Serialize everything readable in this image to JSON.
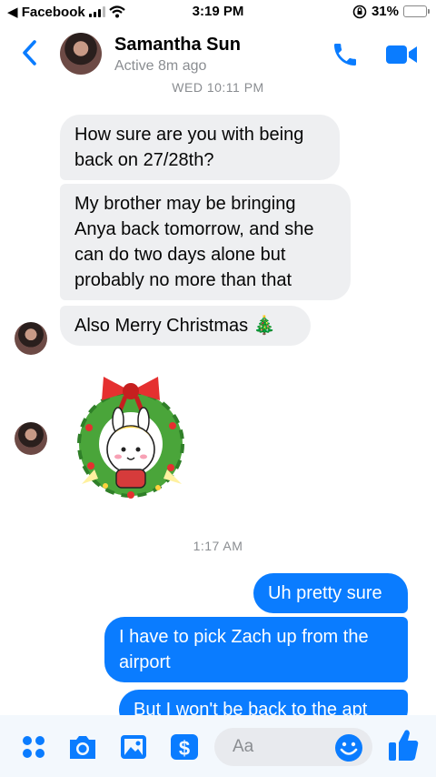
{
  "status_bar": {
    "back_app": "◀ Facebook",
    "time": "3:19 PM",
    "battery_percent": "31%",
    "battery_level": 0.31
  },
  "header": {
    "contact_name": "Samantha Sun",
    "contact_status": "Active 8m ago",
    "icons": [
      "chevron-left-icon",
      "phone-icon",
      "video-camera-icon"
    ]
  },
  "chat": {
    "timestamp_top": "WED 10:11 PM",
    "incoming": [
      "How sure are you with being back on 27/28th?",
      "My brother may be bringing Anya back tomorrow, and she can do two days alone but probably no more than that",
      "Also Merry Christmas 🎄"
    ],
    "sticker": "christmas-wreath-bunny-sticker",
    "timestamp_mid": "1:17 AM",
    "outgoing": [
      "Uh pretty sure",
      "I have to pick Zach up from the airport",
      "But I won't be back to the apt"
    ]
  },
  "composer": {
    "placeholder": "Aa",
    "icons": [
      "menu-dots-icon",
      "camera-icon",
      "gallery-icon",
      "payment-icon",
      "emoji-icon",
      "thumbs-up-icon"
    ]
  },
  "colors": {
    "accent": "#0a7cff",
    "incoming_bubble": "#eeeff1",
    "secondary_text": "#8a8d91"
  }
}
